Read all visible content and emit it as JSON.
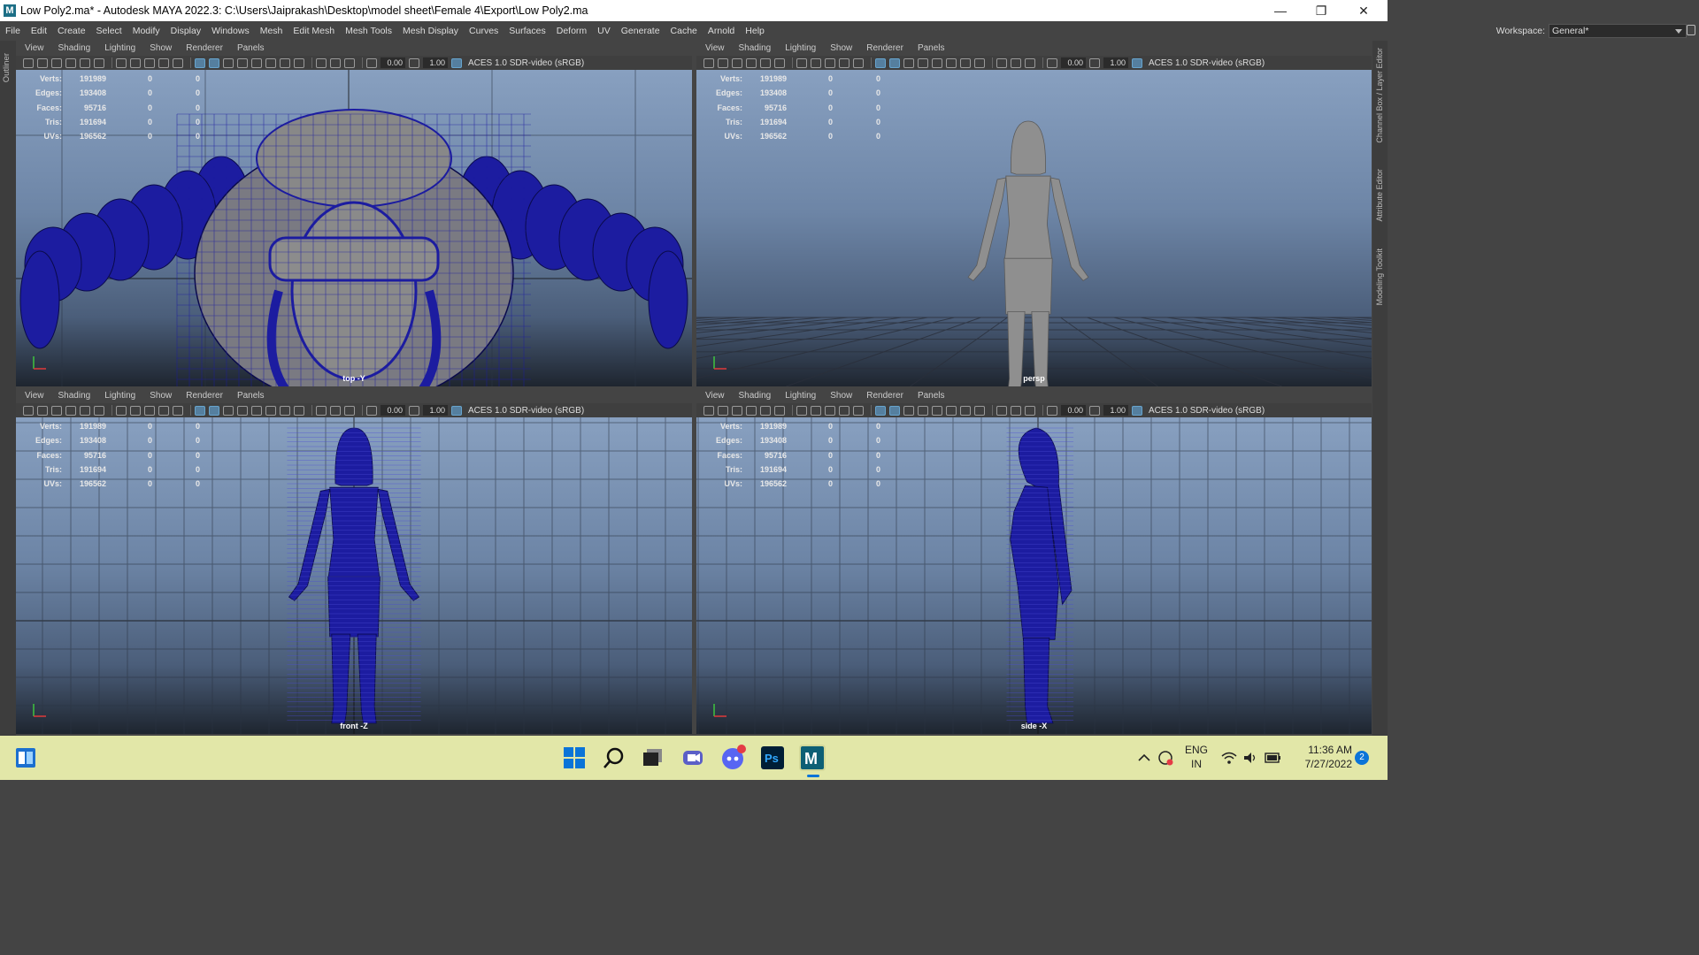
{
  "window": {
    "title": "Low Poly2.ma* - Autodesk MAYA 2022.3: C:\\Users\\Jaiprakash\\Desktop\\model sheet\\Female 4\\Export\\Low Poly2.ma",
    "logo_letter": "M"
  },
  "menubar": {
    "items": [
      "File",
      "Edit",
      "Create",
      "Select",
      "Modify",
      "Display",
      "Windows",
      "Mesh",
      "Edit Mesh",
      "Mesh Tools",
      "Mesh Display",
      "Curves",
      "Surfaces",
      "Deform",
      "UV",
      "Generate",
      "Cache",
      "Arnold",
      "Help"
    ],
    "workspace_label": "Workspace:",
    "workspace_value": "General*"
  },
  "side": {
    "left": "Outliner",
    "right": [
      "Channel Box / Layer Editor",
      "Attribute Editor",
      "Modeling Toolkit"
    ]
  },
  "panel_menu": [
    "View",
    "Shading",
    "Lighting",
    "Show",
    "Renderer",
    "Panels"
  ],
  "toolbar": {
    "exposure": "0.00",
    "gamma": "1.00",
    "colorspace": "ACES 1.0 SDR-video (sRGB)"
  },
  "hud": {
    "labels": [
      "Verts:",
      "Edges:",
      "Faces:",
      "Tris:",
      "UVs:"
    ],
    "values": [
      "191989",
      "193408",
      "95716",
      "191694",
      "196562"
    ],
    "zeros": "0"
  },
  "viewports": [
    {
      "camera": "top -Y",
      "view": "top"
    },
    {
      "camera": "persp",
      "view": "persp"
    },
    {
      "camera": "front -Z",
      "view": "front"
    },
    {
      "camera": "side -X",
      "view": "side"
    }
  ],
  "taskbar": {
    "lang": "ENG",
    "region": "IN",
    "time": "11:36 AM",
    "date": "7/27/2022",
    "notif": "2",
    "ps_label": "Ps",
    "maya_label": "M"
  },
  "colors": {
    "wire": "#1c1ca0",
    "mesh": "#8f8f8f",
    "viewport_top": "#88a0c0",
    "taskbar": "#e2e7a8"
  }
}
